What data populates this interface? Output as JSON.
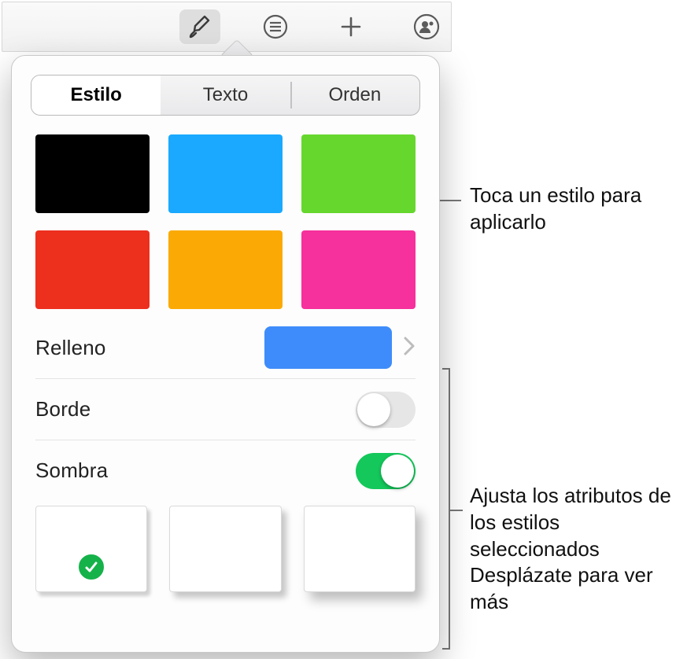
{
  "toolbar": {
    "items": [
      "brush",
      "list",
      "plus",
      "people"
    ],
    "active": "brush"
  },
  "tabs": {
    "style": "Estilo",
    "text": "Texto",
    "order": "Orden",
    "active": "style"
  },
  "style_swatches": [
    "black",
    "blue",
    "green",
    "red",
    "orange",
    "pink"
  ],
  "rows": {
    "fill": {
      "label": "Relleno",
      "color": "#3e8cfb"
    },
    "border": {
      "label": "Borde",
      "on": false
    },
    "shadow": {
      "label": "Sombra",
      "on": true
    }
  },
  "shadow_styles": [
    "sh1",
    "sh2",
    "sh3"
  ],
  "shadow_selected": 0,
  "callouts": {
    "styles": "Toca un estilo para aplicarlo",
    "attrs": "Ajusta los atributos de los estilos seleccionados Desplázate para ver más"
  }
}
